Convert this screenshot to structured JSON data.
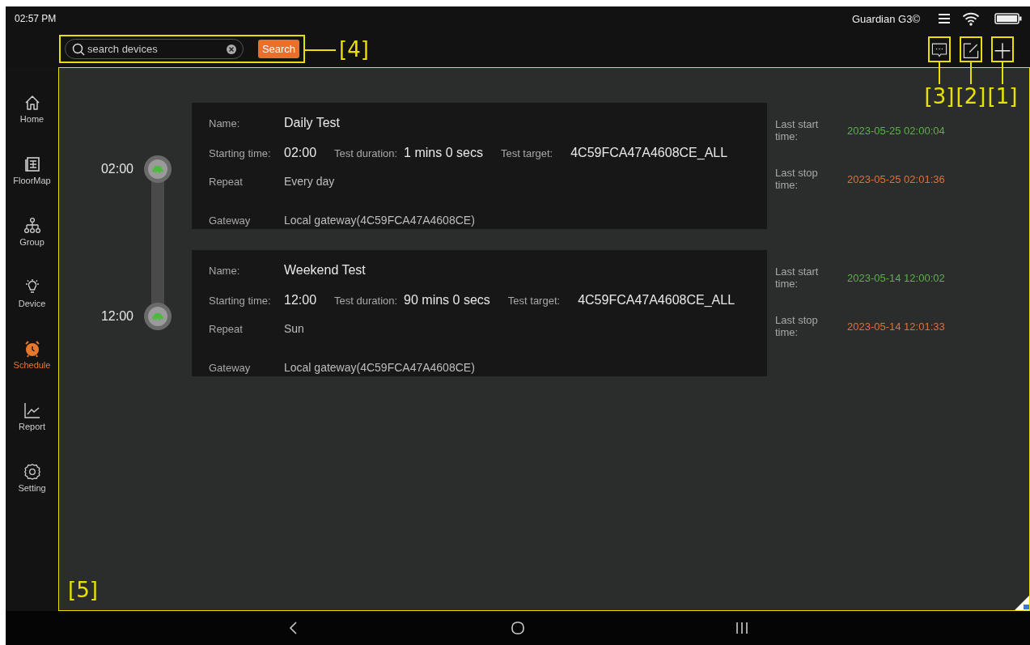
{
  "status_bar": {
    "time": "02:57 PM",
    "device_name": "Guardian G3©"
  },
  "toolbar": {
    "search": {
      "placeholder": "search devices",
      "button": "Search",
      "callout": "[4]"
    },
    "actions": [
      {
        "kind": "chat",
        "callout": "[3]"
      },
      {
        "kind": "edit",
        "callout": "[2]"
      },
      {
        "kind": "add",
        "callout": "[1]"
      }
    ]
  },
  "sidebar": {
    "items": [
      {
        "kind": "home",
        "label": "Home",
        "selected": false
      },
      {
        "kind": "floormap",
        "label": "FloorMap",
        "selected": false
      },
      {
        "kind": "group",
        "label": "Group",
        "selected": false
      },
      {
        "kind": "device",
        "label": "Device",
        "selected": false
      },
      {
        "kind": "schedule",
        "label": "Schedule",
        "selected": true
      },
      {
        "kind": "report",
        "label": "Report",
        "selected": false
      },
      {
        "kind": "setting",
        "label": "Setting",
        "selected": false
      }
    ]
  },
  "content": {
    "callout": "[5]",
    "schedules": [
      {
        "time": "02:00",
        "name_label": "Name:",
        "name": "Daily Test",
        "start_label": "Starting time:",
        "start": "02:00",
        "duration_label": "Test duration:",
        "duration": "1 mins 0 secs",
        "target_label": "Test target:",
        "target": "4C59FCA47A4608CE_ALL",
        "repeat_label": "Repeat",
        "repeat": "Every day",
        "gateway_label": "Gateway",
        "gateway": "Local gateway(4C59FCA47A4608CE)",
        "last_start_label": "Last start time:",
        "last_start": "2023-05-25 02:00:04",
        "last_stop_label": "Last stop time:",
        "last_stop": "2023-05-25 02:01:36"
      },
      {
        "time": "12:00",
        "name_label": "Name:",
        "name": "Weekend Test",
        "start_label": "Starting time:",
        "start": "12:00",
        "duration_label": "Test duration:",
        "duration": "90 mins 0 secs",
        "target_label": "Test target:",
        "target": "4C59FCA47A4608CE_ALL",
        "repeat_label": "Repeat",
        "repeat": "Sun",
        "gateway_label": "Gateway",
        "gateway": "Local gateway(4C59FCA47A4608CE)",
        "last_start_label": "Last start time:",
        "last_start": "2023-05-14 12:00:02",
        "last_stop_label": "Last stop time:",
        "last_stop": "2023-05-14 12:01:33"
      }
    ]
  }
}
